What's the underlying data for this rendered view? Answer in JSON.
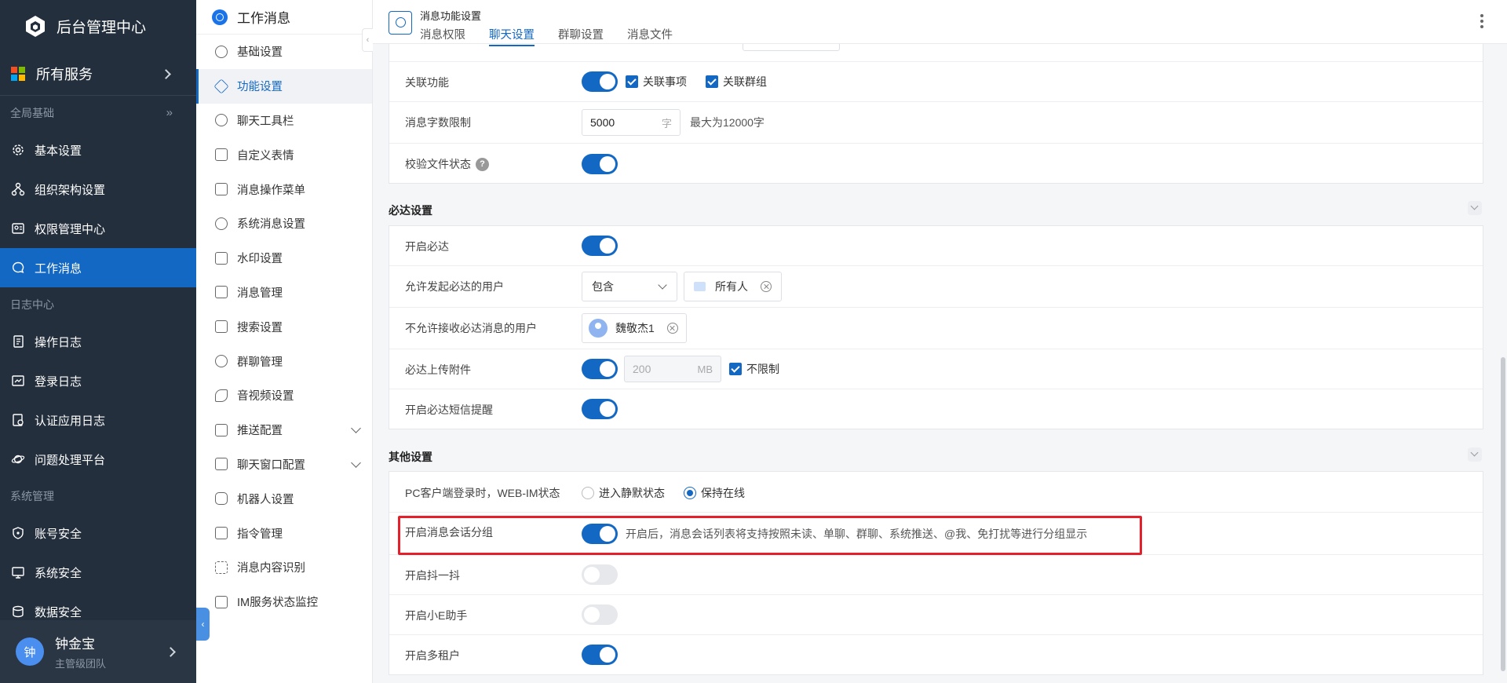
{
  "sidebar": {
    "brand": "后台管理中心",
    "all_services": "所有服务",
    "groups": [
      {
        "title": "全局基础",
        "items": [
          "基本设置",
          "组织架构设置",
          "权限管理中心",
          "工作消息"
        ]
      },
      {
        "title": "日志中心",
        "items": [
          "操作日志",
          "登录日志",
          "认证应用日志",
          "问题处理平台"
        ]
      },
      {
        "title": "系统管理",
        "items": [
          "账号安全",
          "系统安全",
          "数据安全"
        ]
      }
    ],
    "active_item": "工作消息",
    "user": {
      "avatar": "钟",
      "name": "钟金宝",
      "team": "主管级团队"
    }
  },
  "subnav": {
    "title": "工作消息",
    "items": [
      "基础设置",
      "功能设置",
      "聊天工具栏",
      "自定义表情",
      "消息操作菜单",
      "系统消息设置",
      "水印设置",
      "消息管理",
      "搜索设置",
      "群聊管理",
      "音视频设置",
      "推送配置",
      "聊天窗口配置",
      "机器人设置",
      "指令管理",
      "消息内容识别",
      "IM服务状态监控"
    ],
    "active_item": "功能设置"
  },
  "header": {
    "title": "消息功能设置",
    "tabs": [
      "消息权限",
      "聊天设置",
      "群聊设置",
      "消息文件"
    ],
    "active_tab": "聊天设置"
  },
  "content": {
    "top_card": {
      "link_label": "关联功能",
      "link_options": [
        "关联事项",
        "关联群组"
      ],
      "char_limit_label": "消息字数限制",
      "char_limit_value": "5000",
      "char_limit_unit": "字",
      "char_limit_hint": "最大为12000字",
      "verify_label": "校验文件状态",
      "verify_help": "?"
    },
    "bida": {
      "title": "必达设置",
      "enable_label": "开启必达",
      "allowed_label": "允许发起必达的用户",
      "allowed_mode": "包含",
      "allowed_target": "所有人",
      "denied_label": "不允许接收必达消息的用户",
      "denied_user": "魏敬杰1",
      "upload_label": "必达上传附件",
      "upload_value": "200",
      "upload_unit": "MB",
      "upload_unlimited": "不限制",
      "sms_label": "开启必达短信提醒"
    },
    "other": {
      "title": "其他设置",
      "pc_label": "PC客户端登录时，WEB-IM状态",
      "pc_options": [
        "进入静默状态",
        "保持在线"
      ],
      "pc_selected": "保持在线",
      "group_label": "开启消息会话分组",
      "group_hint": "开启后，消息会话列表将支持按照未读、单聊、群聊、系统推送、@我、免打扰等进行分组显示",
      "shake_label": "开启抖一抖",
      "xiaoe_label": "开启小E助手",
      "tenant_label": "开启多租户"
    }
  },
  "colors": {
    "sidebar_bg": "#242f3d",
    "accent": "#1368c4",
    "highlight": "#e5202a"
  }
}
